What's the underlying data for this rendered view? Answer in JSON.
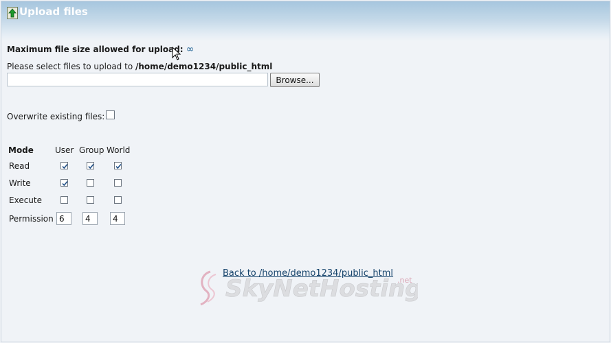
{
  "header": {
    "title": "Upload files",
    "icon": "upload-arrow-icon"
  },
  "upload": {
    "max_size_label": "Maximum file size allowed for upload:",
    "max_size_value": "∞",
    "select_prefix": "Please select files to upload to",
    "target_path": "/home/demo1234/public_html",
    "file_value": "",
    "browse_label": "Browse..."
  },
  "overwrite": {
    "label": "Overwrite existing files:",
    "checked": false
  },
  "permissions": {
    "header": {
      "mode": "Mode",
      "user": "User",
      "group": "Group",
      "world": "World"
    },
    "rows": [
      {
        "label": "Read",
        "user": true,
        "group": true,
        "world": true
      },
      {
        "label": "Write",
        "user": true,
        "group": false,
        "world": false
      },
      {
        "label": "Execute",
        "user": false,
        "group": false,
        "world": false
      }
    ],
    "permission_label": "Permission",
    "values": {
      "user": "6",
      "group": "4",
      "world": "4"
    }
  },
  "back_link": "Back to /home/demo1234/public_html",
  "watermark": {
    "text": "SkyNetHosting",
    "suffix": ".net",
    "color": "#d9a3b3"
  }
}
